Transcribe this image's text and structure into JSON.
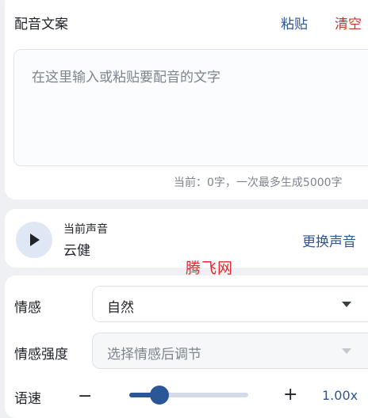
{
  "text_card": {
    "title": "配音文案",
    "paste_label": "粘贴",
    "clear_label": "清空",
    "placeholder": "在这里输入或粘贴要配音的文字",
    "counter": "当前：0字，一次最多生成5000字"
  },
  "voice_card": {
    "current_label": "当前声音",
    "voice_name": "云健",
    "change_label": "更换声音"
  },
  "watermark": "腾飞网",
  "settings": {
    "emotion_label": "情感",
    "emotion_value": "自然",
    "intensity_label": "情感强度",
    "intensity_placeholder": "选择情感后调节",
    "speed_label": "语速",
    "speed_minus": "−",
    "speed_plus": "+",
    "speed_value": "1.00x",
    "speed_fraction": 0.25
  },
  "colors": {
    "accent": "#2b5797",
    "danger": "#c0392b",
    "watermark": "#e8262b"
  }
}
